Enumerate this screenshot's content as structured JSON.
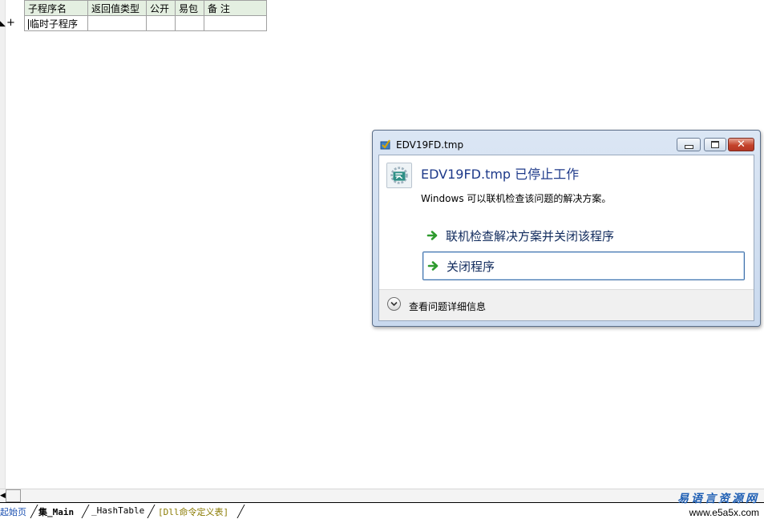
{
  "table": {
    "headers": [
      "子程序名",
      "返回值类型",
      "公开",
      "易包",
      "备 注"
    ],
    "rows": [
      [
        "临时子程序",
        "",
        "",
        "",
        ""
      ]
    ]
  },
  "gutter": {
    "expand_symbol": "+"
  },
  "dialog": {
    "title": "EDV19FD.tmp",
    "heading": "EDV19FD.tmp 已停止工作",
    "description": "Windows 可以联机检查该问题的解决方案。",
    "option_check_online": "联机检查解决方案并关闭该程序",
    "option_close": "关闭程序",
    "details_label": "查看问题详细信息",
    "accent_color": "#1e3a8a",
    "arrow_color": "#2e9b2e"
  },
  "tabs": [
    "起始页",
    "集_Main",
    "_HashTable",
    "[Dll命令定义表]"
  ],
  "watermark": {
    "text": "易语言资源网",
    "url": "www.e5a5x.com"
  }
}
